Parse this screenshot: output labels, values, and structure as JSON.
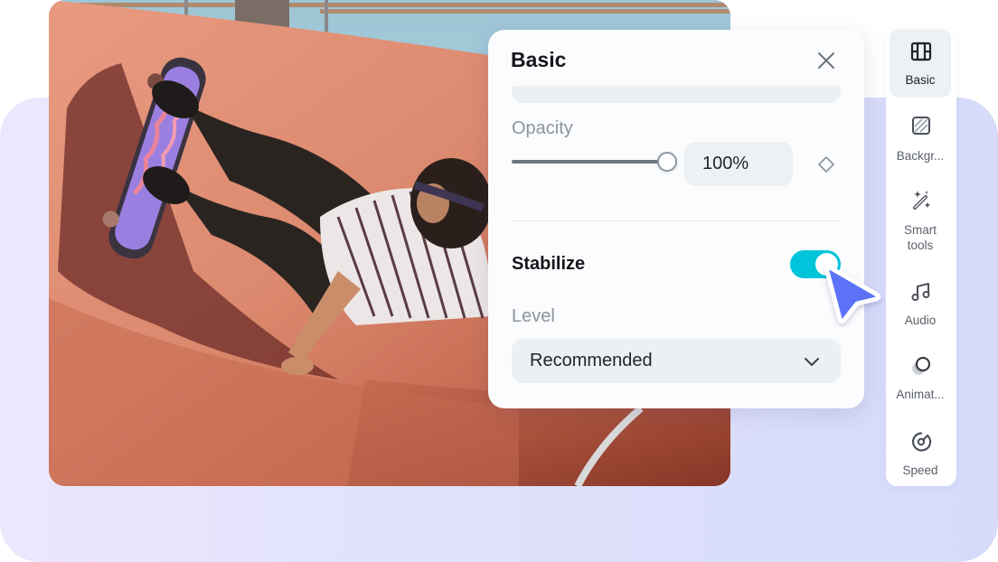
{
  "panel": {
    "title": "Basic",
    "close_icon": "close-icon",
    "opacity": {
      "label": "Opacity",
      "value_percent": 100,
      "value_text": "100%",
      "keyframe_icon": "diamond-keyframe-icon"
    },
    "stabilize": {
      "label": "Stabilize",
      "enabled": true,
      "level_label": "Level",
      "level_value": "Recommended",
      "chevron_icon": "chevron-down-icon"
    }
  },
  "toolbar": {
    "items": [
      {
        "label": "Basic",
        "icon": "film-icon",
        "active": true
      },
      {
        "label": "Backgr...",
        "icon": "background-icon",
        "active": false
      },
      {
        "label": "Smart\ntools",
        "icon": "magic-wand-icon",
        "active": false
      },
      {
        "label": "Audio",
        "icon": "music-note-icon",
        "active": false
      },
      {
        "label": "Animat...",
        "icon": "animation-icon",
        "active": false
      },
      {
        "label": "Speed",
        "icon": "speedometer-icon",
        "active": false
      }
    ]
  },
  "colors": {
    "accent_toggle": "#00c4d9",
    "cursor": "#5b73f8",
    "backdrop_start": "#ebe8fd",
    "backdrop_end": "#d6dbfa"
  }
}
